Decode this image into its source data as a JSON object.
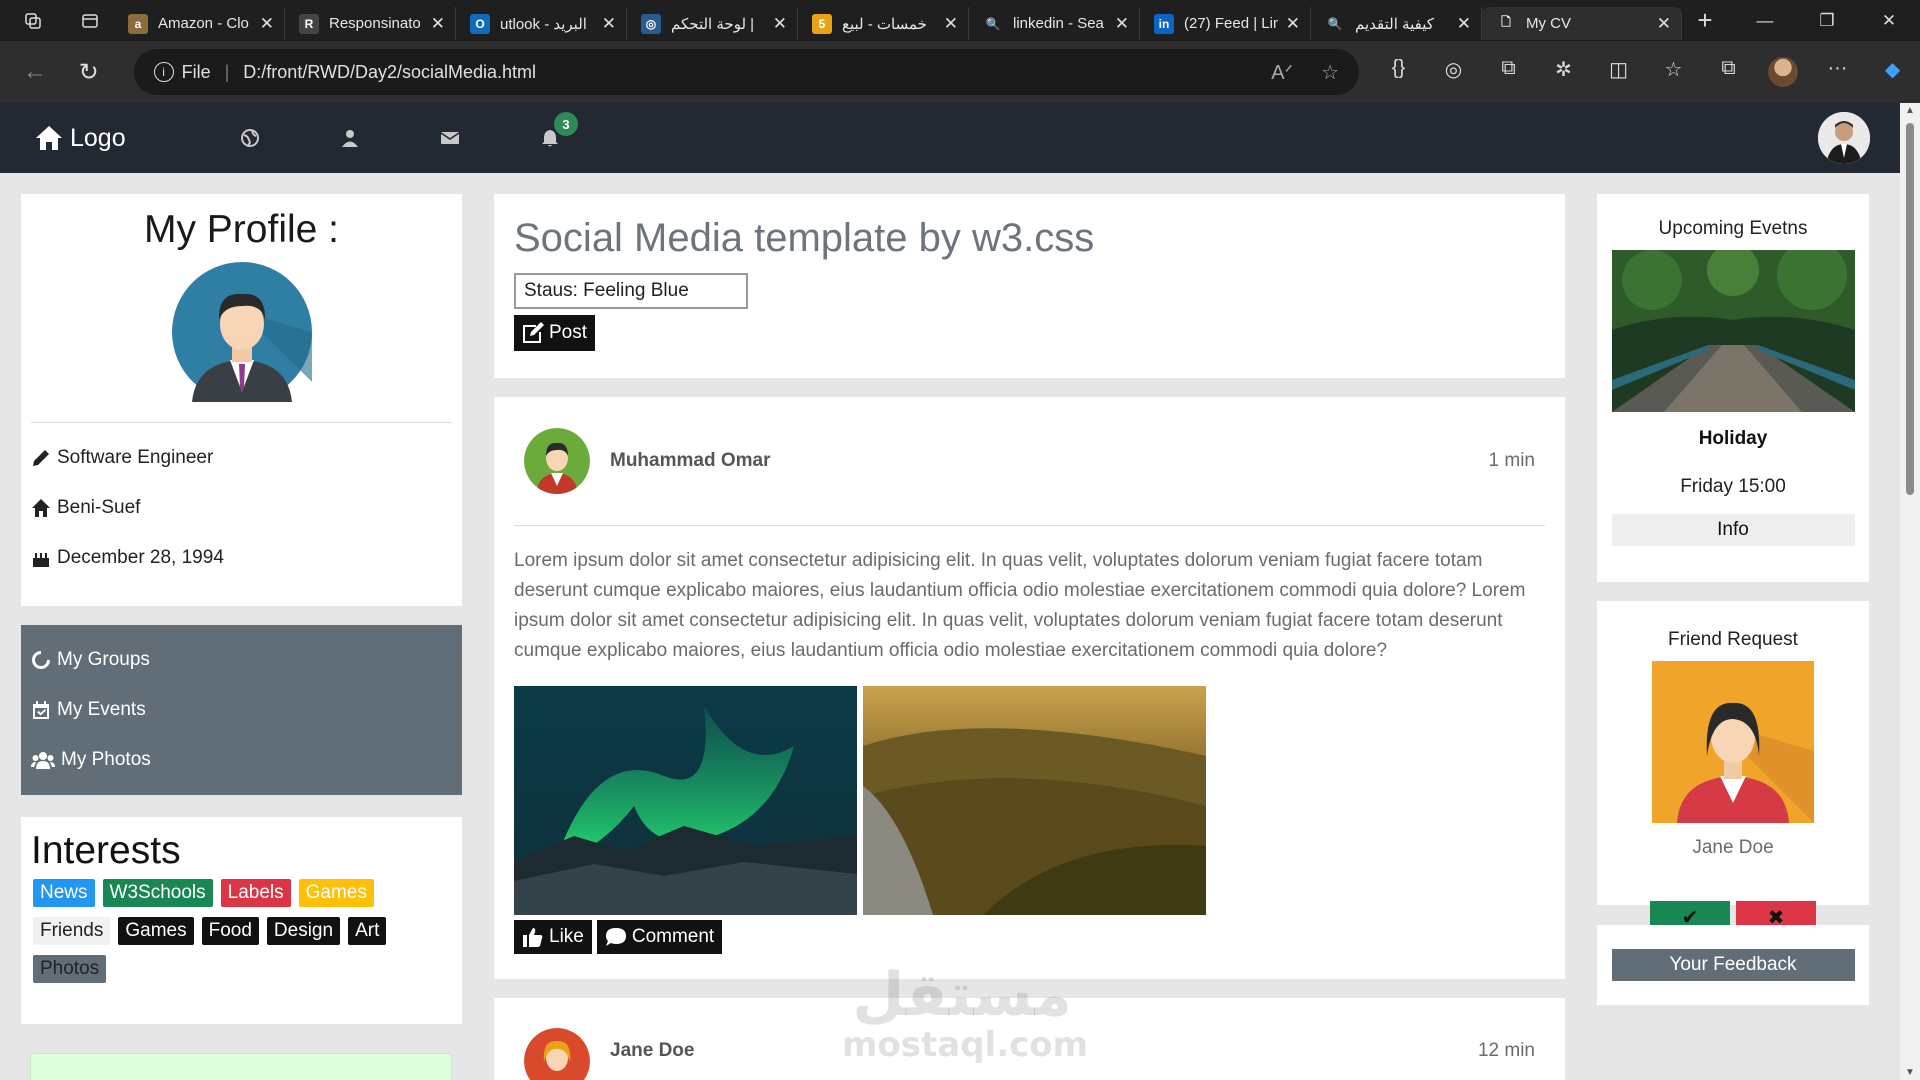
{
  "browser": {
    "tabs": [
      {
        "title": "Amazon - Clo",
        "fav_color": "#8a6d3b",
        "fav_glyph": "a"
      },
      {
        "title": "Responsinato",
        "fav_color": "#444444",
        "fav_glyph": "R"
      },
      {
        "title": "utlook - البريد",
        "fav_color": "#0f6cbd",
        "fav_glyph": "O"
      },
      {
        "title": "لوحة التحكم |",
        "fav_color": "#2a5d8f",
        "fav_glyph": "◎"
      },
      {
        "title": "خمسات - لبيع",
        "fav_color": "#e8a317",
        "fav_glyph": "5"
      },
      {
        "title": "linkedin - Sea",
        "fav_color": "#1f1f1f",
        "fav_glyph": "🔍"
      },
      {
        "title": "(27) Feed | Lin",
        "fav_color": "#0a66c2",
        "fav_glyph": "in"
      },
      {
        "title": "كيفية التقديم",
        "fav_color": "#1f1f1f",
        "fav_glyph": "🔍"
      },
      {
        "title": "My CV",
        "fav_color": "#2e2e2e",
        "fav_glyph": "🗋"
      }
    ],
    "address": {
      "scheme": "File",
      "path": "D:/front/RWD/Day2/socialMedia.html"
    }
  },
  "nav": {
    "logo": "Logo",
    "badge": "3"
  },
  "profile": {
    "title": "My Profile :",
    "job": "Software Engineer",
    "city": "Beni-Suef",
    "birthday": "December 28, 1994"
  },
  "menu": {
    "groups": "My Groups",
    "events": "My Events",
    "photos": "My Photos"
  },
  "interests": {
    "title": "Interests",
    "tags": [
      {
        "label": "News",
        "color": "#2196f3"
      },
      {
        "label": "W3Schools",
        "color": "#198754"
      },
      {
        "label": "Labels",
        "color": "#dc3545"
      },
      {
        "label": "Games",
        "color": "#ffc107"
      },
      {
        "label": "Friends",
        "color": "#f1f1f1"
      },
      {
        "label": "Games",
        "color": "#111111"
      },
      {
        "label": "Food",
        "color": "#111111"
      },
      {
        "label": "Design",
        "color": "#111111"
      },
      {
        "label": "Art",
        "color": "#111111"
      },
      {
        "label": "Photos",
        "color": "#616e78"
      }
    ]
  },
  "status": {
    "title": "Social Media template by w3.css",
    "input_value": "Staus: Feeling Blue",
    "post_label": "Post"
  },
  "posts": [
    {
      "author": "Muhammad Omar",
      "time": "1 min",
      "text": "Lorem ipsum dolor sit amet consectetur adipisicing elit. In quas velit, voluptates dolorum veniam fugiat facere totam deserunt cumque explicabo maiores, eius laudantium officia odio molestiae exercitationem commodi quia dolore? Lorem ipsum dolor sit amet consectetur adipisicing elit. In quas velit, voluptates dolorum veniam fugiat facere totam deserunt cumque explicabo maiores, eius laudantium officia odio molestiae exercitationem commodi quia dolore?",
      "like_label": "Like",
      "comment_label": "Comment"
    },
    {
      "author": "Jane Doe",
      "time": "12 min"
    }
  ],
  "events": {
    "title": "Upcoming Evetns",
    "name": "Holiday",
    "when": "Friday 15:00",
    "info_label": "Info"
  },
  "friend_request": {
    "title": "Friend Request",
    "name": "Jane Doe",
    "accept_icon": "check-icon",
    "decline_icon": "close-icon"
  },
  "feedback": {
    "label": "Your Feedback"
  },
  "watermark": {
    "arabic": "مستقل",
    "latin": "mostaql.com"
  }
}
